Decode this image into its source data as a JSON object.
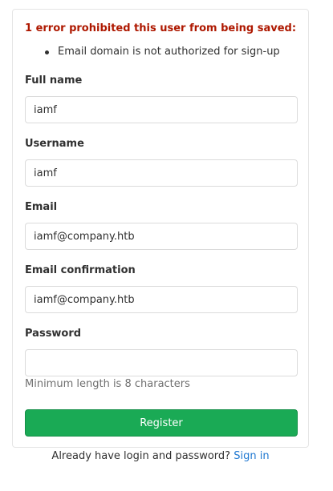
{
  "error": {
    "title": "1 error prohibited this user from being saved:",
    "items": [
      "Email domain is not authorized for sign-up"
    ]
  },
  "fields": {
    "full_name": {
      "label": "Full name",
      "value": "iamf"
    },
    "username": {
      "label": "Username",
      "value": "iamf"
    },
    "email": {
      "label": "Email",
      "value": "iamf@company.htb"
    },
    "email_confirmation": {
      "label": "Email confirmation",
      "value": "iamf@company.htb"
    },
    "password": {
      "label": "Password",
      "value": "",
      "hint": "Minimum length is 8 characters"
    }
  },
  "register_label": "Register",
  "footer": {
    "text": "Already have login and password?",
    "link": "Sign in"
  },
  "colors": {
    "error": "#ae1800",
    "primary_button": "#1aaa55",
    "link": "#1f78d1"
  }
}
